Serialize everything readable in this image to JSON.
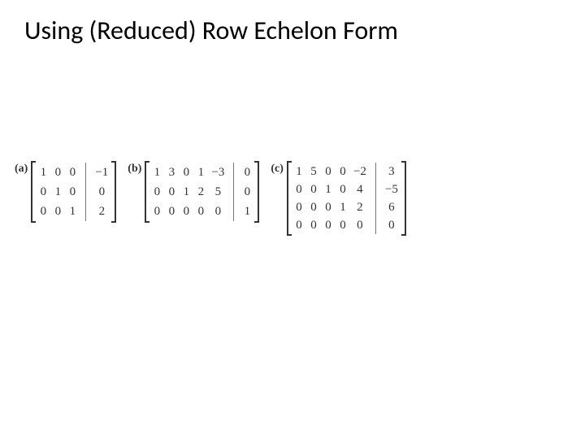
{
  "title": "Using (Reduced) Row Echelon Form",
  "examples": {
    "a": {
      "label": "(a)",
      "cols": [
        [
          "1",
          "0",
          "0"
        ],
        [
          "0",
          "1",
          "0"
        ],
        [
          "0",
          "0",
          "1"
        ]
      ],
      "aug": [
        "−1",
        "0",
        "2"
      ]
    },
    "b": {
      "label": "(b)",
      "cols": [
        [
          "1",
          "0",
          "0"
        ],
        [
          "3",
          "0",
          "0"
        ],
        [
          "0",
          "1",
          "0"
        ],
        [
          "1",
          "2",
          "0"
        ],
        [
          "−3",
          "5",
          "0"
        ]
      ],
      "aug": [
        "0",
        "0",
        "1"
      ]
    },
    "c": {
      "label": "(c)",
      "cols": [
        [
          "1",
          "0",
          "0",
          "0"
        ],
        [
          "5",
          "0",
          "0",
          "0"
        ],
        [
          "0",
          "1",
          "0",
          "0"
        ],
        [
          "0",
          "0",
          "1",
          "0"
        ],
        [
          "−2",
          "4",
          "2",
          "0"
        ]
      ],
      "aug": [
        "3",
        "−5",
        "6",
        "0"
      ]
    }
  }
}
